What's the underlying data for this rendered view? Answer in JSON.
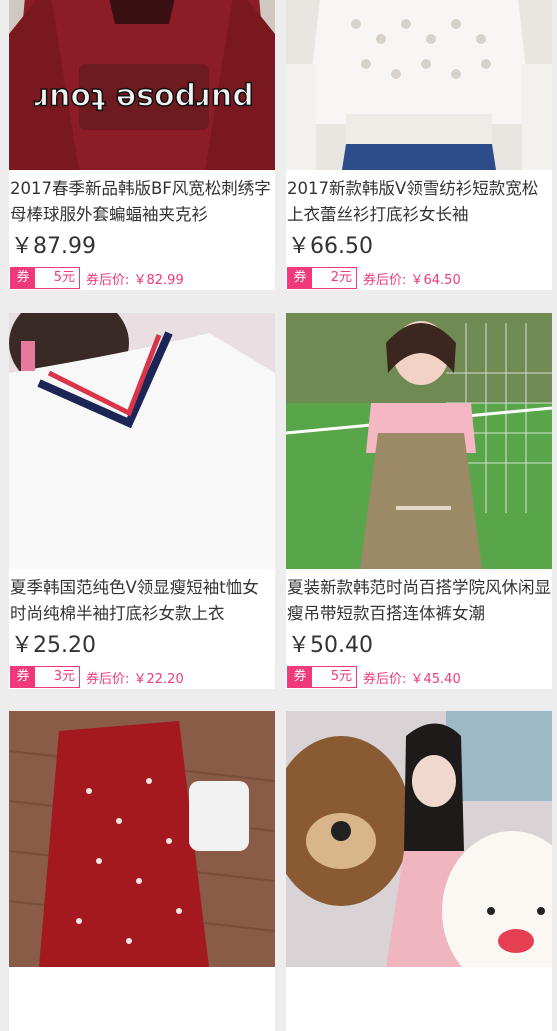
{
  "products": [
    {
      "title": "2017春季新品韩版BF风宽松刺绣字母棒球服外套蝙蝠袖夹克衫",
      "price": "￥87.99",
      "coupon_tag": "券",
      "coupon_amount": "5元",
      "after_price": "券后价: ￥82.99",
      "image_text": "purpose tour"
    },
    {
      "title": "2017新款韩版V领雪纺衫短款宽松上衣蕾丝衫打底衫女长袖",
      "price": "￥66.50",
      "coupon_tag": "券",
      "coupon_amount": "2元",
      "after_price": "券后价: ￥64.50"
    },
    {
      "title": "夏季韩国范纯色V领显瘦短袖t恤女时尚纯棉半袖打底衫女款上衣",
      "price": "￥25.20",
      "coupon_tag": "券",
      "coupon_amount": "3元",
      "after_price": "券后价: ￥22.20"
    },
    {
      "title": "夏装新款韩范时尚百搭学院风休闲显瘦吊带短款百搭连体裤女潮",
      "price": "￥50.40",
      "coupon_tag": "券",
      "coupon_amount": "5元",
      "after_price": "券后价: ￥45.40"
    },
    {
      "title": "",
      "price": ""
    },
    {
      "title": "",
      "price": ""
    }
  ]
}
